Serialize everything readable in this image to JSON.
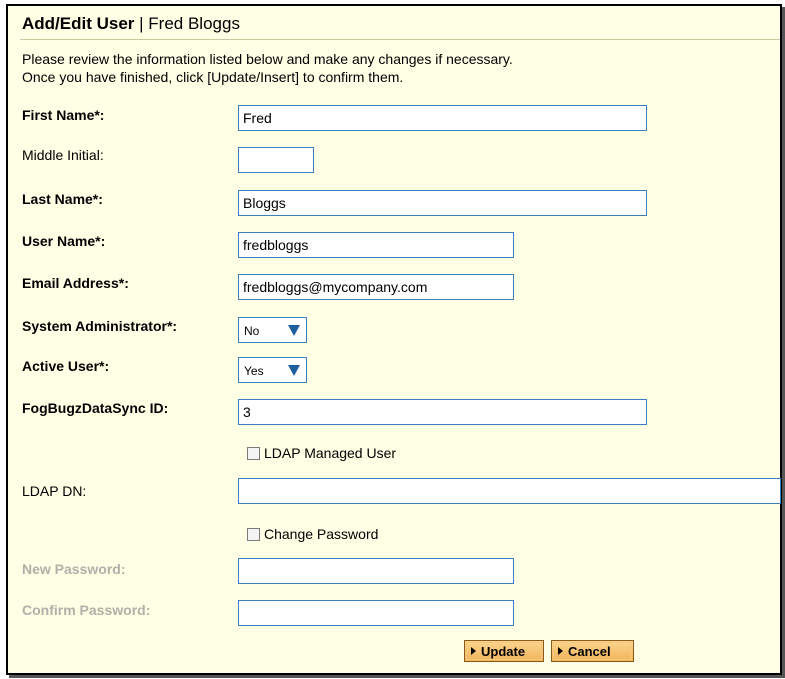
{
  "header": {
    "title_bold": "Add/Edit User",
    "title_separator": " | ",
    "title_name": "Fred Bloggs"
  },
  "intro": {
    "line1": "Please review the information listed below and make any changes if necessary.",
    "line2": "Once you have finished, click [Update/Insert] to confirm them."
  },
  "fields": {
    "first_name": {
      "label": "First Name*:",
      "value": "Fred"
    },
    "middle_initial": {
      "label": "Middle Initial:",
      "value": ""
    },
    "last_name": {
      "label": "Last Name*:",
      "value": "Bloggs"
    },
    "user_name": {
      "label": "User Name*:",
      "value": "fredbloggs"
    },
    "email": {
      "label": "Email Address*:",
      "value": "fredbloggs@mycompany.com"
    },
    "system_admin": {
      "label": "System Administrator*:",
      "value": "No"
    },
    "active_user": {
      "label": "Active User*:",
      "value": "Yes"
    },
    "fogbugz_id": {
      "label": "FogBugzDataSync ID:",
      "value": "3"
    },
    "ldap_managed": {
      "label": "LDAP Managed User",
      "checked": false
    },
    "ldap_dn": {
      "label": "LDAP DN:",
      "value": ""
    },
    "change_password": {
      "label": "Change Password",
      "checked": false
    },
    "new_password": {
      "label": "New Password:",
      "value": ""
    },
    "confirm_password": {
      "label": "Confirm Password:",
      "value": ""
    }
  },
  "buttons": {
    "update": "Update",
    "cancel": "Cancel"
  },
  "colors": {
    "panel_bg": "#ffffe6",
    "input_border": "#3b7fbf",
    "button_bg": "#f2b45a",
    "disabled_label": "#b0b0a8"
  }
}
